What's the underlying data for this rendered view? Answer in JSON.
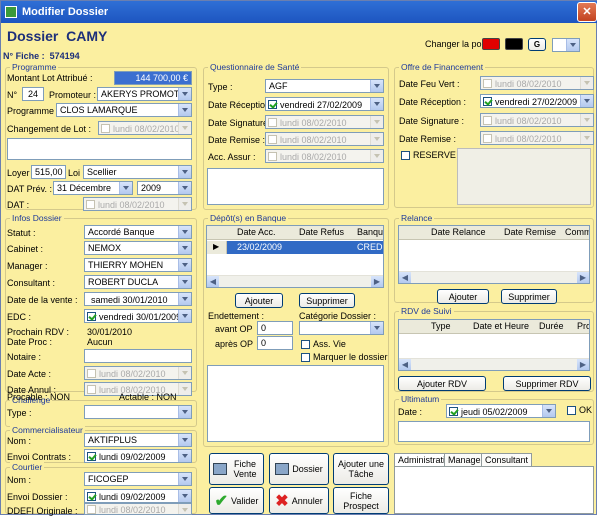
{
  "window": {
    "title": "Modifier Dossier"
  },
  "header": {
    "dossier_label": "Dossier",
    "client_name": "CAMY",
    "fiche_label": "N° Fiche :",
    "fiche_value": "574194",
    "font_label": "Changer la police :",
    "font_button": "G"
  },
  "colors": {
    "swatch_red": "#e00000",
    "swatch_black": "#000000"
  },
  "programme": {
    "title": "Programme",
    "montant_label": "Montant Lot Attribué :",
    "montant_value": "144 700,00 €",
    "n_label": "N°",
    "n_value": "24",
    "promoteur_label": "Promoteur :",
    "promoteur_value": "AKERYS PROMOT",
    "programme_label": "Programme :",
    "programme_value": "CLOS LAMARQUE",
    "changement_label": "Changement de Lot :",
    "changement_date": "lundi    08/02/2010",
    "loyer_label": "Loyer :",
    "loyer_value": "515,00 €",
    "loi_label": "Loi :",
    "loi_value": "Scellier",
    "datprev_label": "DAT Prév. :",
    "datprev_month": "31 Décembre",
    "datprev_year": "2009",
    "dat_label": "DAT :",
    "dat_date": "lundi    08/02/2010"
  },
  "infos": {
    "title": "Infos Dossier",
    "statut_label": "Statut :",
    "statut_value": "Accordé Banque",
    "cabinet_label": "Cabinet :",
    "cabinet_value": "NEMOX",
    "manager_label": "Manager :",
    "manager_value": "THIERRY MOHEN",
    "consultant_label": "Consultant :",
    "consultant_value": "ROBERT DUCLA",
    "datevente_label": "Date de la vente :",
    "datevente_value": "samedi   30/01/2010",
    "edc_label": "EDC :",
    "edc_value": "vendredi 30/01/2009",
    "rdv_label": "Prochain RDV :",
    "rdv_value": "30/01/2010",
    "proc_label": "Date Proc :",
    "proc_value": "Aucun",
    "notaire_label": "Notaire :",
    "acte_label": "Date Acte :",
    "acte_date": "lundi    08/02/2010",
    "annul_label": "Date Annul :",
    "annul_date": "lundi    08/02/2010",
    "procable": "Procable : NON",
    "actable": "Actable : NON"
  },
  "challenge": {
    "title": "Challenge",
    "type_label": "Type :"
  },
  "commercialisateur": {
    "title": "Commercialisateur",
    "nom_label": "Nom :",
    "nom_value": "AKTIFPLUS",
    "envoi_label": "Envoi Contrats :",
    "envoi_value": "lundi    09/02/2009"
  },
  "courtier": {
    "title": "Courtier",
    "nom_label": "Nom :",
    "nom_value": "FICOGEP",
    "envoi_label": "Envoi Dossier :",
    "envoi_value": "lundi    09/02/2009",
    "ddefi_label": "DDEFI Originale :",
    "ddefi_value": "lundi    08/02/2010"
  },
  "sante": {
    "title": "Questionnaire de Santé",
    "type_label": "Type :",
    "type_value": "AGF",
    "reception_label": "Date Réception :",
    "reception_value": "vendredi 27/02/2009",
    "signature_label": "Date Signature :",
    "signature_value": "lundi    08/02/2010",
    "remise_label": "Date Remise :",
    "remise_value": "lundi    08/02/2010",
    "assur_label": "Acc. Assur :",
    "assur_value": "lundi    08/02/2010"
  },
  "depots": {
    "title": "Dépôt(s) en Banque",
    "columns": [
      "Date Acc.",
      "Date Refus",
      "Banque"
    ],
    "rows": [
      {
        "date_acc": "23/02/2009",
        "date_refus": "",
        "banque": "CREDIT"
      }
    ],
    "add_button": "Ajouter",
    "delete_button": "Supprimer",
    "endettement_label": "Endettement :",
    "avant_label": "avant OP",
    "avant_value": "0",
    "apres_label": "après OP",
    "apres_value": "0",
    "categorie_label": "Catégorie Dossier :",
    "assvie_label": "Ass. Vie",
    "marquer_label": "Marquer le dossier"
  },
  "financement": {
    "title": "Offre de Financement",
    "feuvert_label": "Date Feu Vert :",
    "feuvert_value": "lundi    08/02/2010",
    "reception_label": "Date Réception :",
    "reception_value": "vendredi 27/02/2009",
    "signature_label": "Date Signature :",
    "signature_value": "lundi    08/02/2010",
    "remise_label": "Date Remise :",
    "remise_value": "lundi    08/02/2010",
    "reserve_label": "RESERVE"
  },
  "relance": {
    "title": "Relance",
    "columns": [
      "Date Relance",
      "Date Remise",
      "Commen"
    ],
    "add_button": "Ajouter",
    "delete_button": "Supprimer"
  },
  "rdv": {
    "title": "RDV de Suivi",
    "columns": [
      "Type",
      "Date et Heure",
      "Durée",
      "Pro"
    ],
    "add_button": "Ajouter RDV",
    "delete_button": "Supprimer RDV"
  },
  "ultimatum": {
    "title": "Ultimatum",
    "date_label": "Date :",
    "date_value": "jeudi    05/02/2009",
    "ok_label": "OK"
  },
  "actions": {
    "fiche_vente": "Fiche Vente",
    "dossier": "Dossier",
    "ajouter_tache": "Ajouter une Tâche",
    "valider": "Valider",
    "annuler": "Annuler",
    "fiche_prospect": "Fiche Prospect"
  },
  "tabs": [
    "Administratif",
    "Manager",
    "Consultant"
  ]
}
